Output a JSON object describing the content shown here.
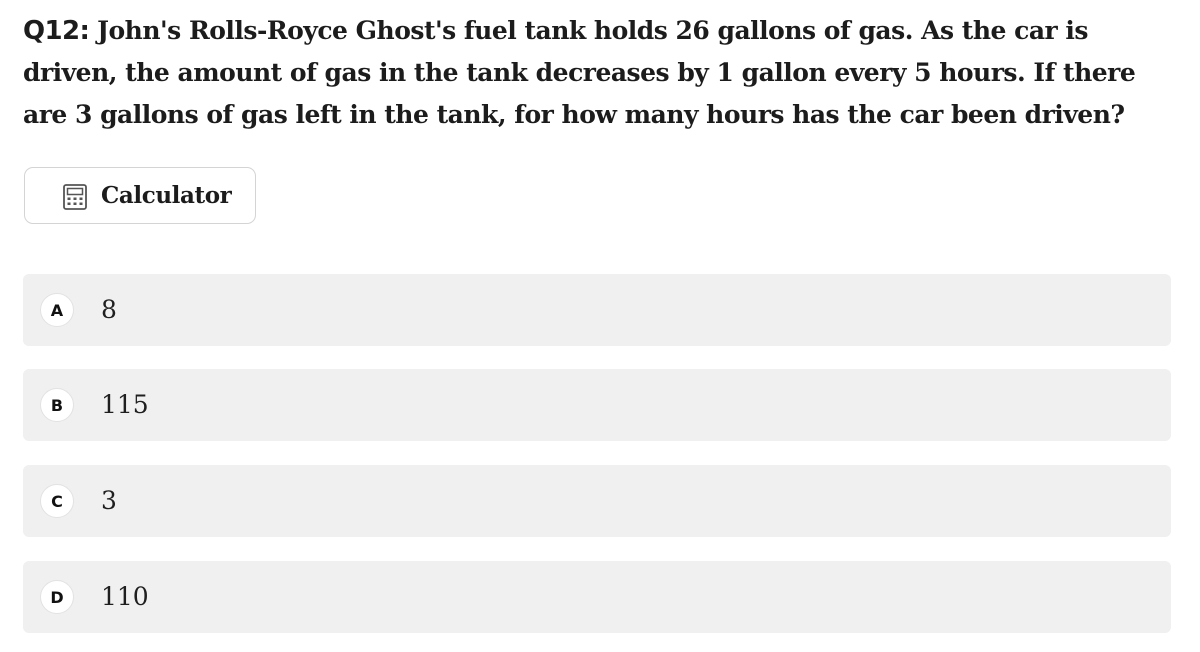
{
  "question": {
    "number": "Q12:",
    "text": "John's Rolls-Royce Ghost's fuel tank holds 26 gallons of gas. As the car is driven, the amount of gas in the tank decreases by 1 gallon every 5 hours. If there are 3 gallons of gas left in the tank, for how many hours has the car been driven?"
  },
  "calculator": {
    "label": "Calculator",
    "icon": "calculator-icon"
  },
  "choices": [
    {
      "letter": "A",
      "value": "8"
    },
    {
      "letter": "B",
      "value": "115"
    },
    {
      "letter": "C",
      "value": "3"
    },
    {
      "letter": "D",
      "value": "110"
    }
  ],
  "colors": {
    "choice_background": "#f0f0f0",
    "text": "#1c1c1c",
    "button_border": "#d4d4d4"
  }
}
